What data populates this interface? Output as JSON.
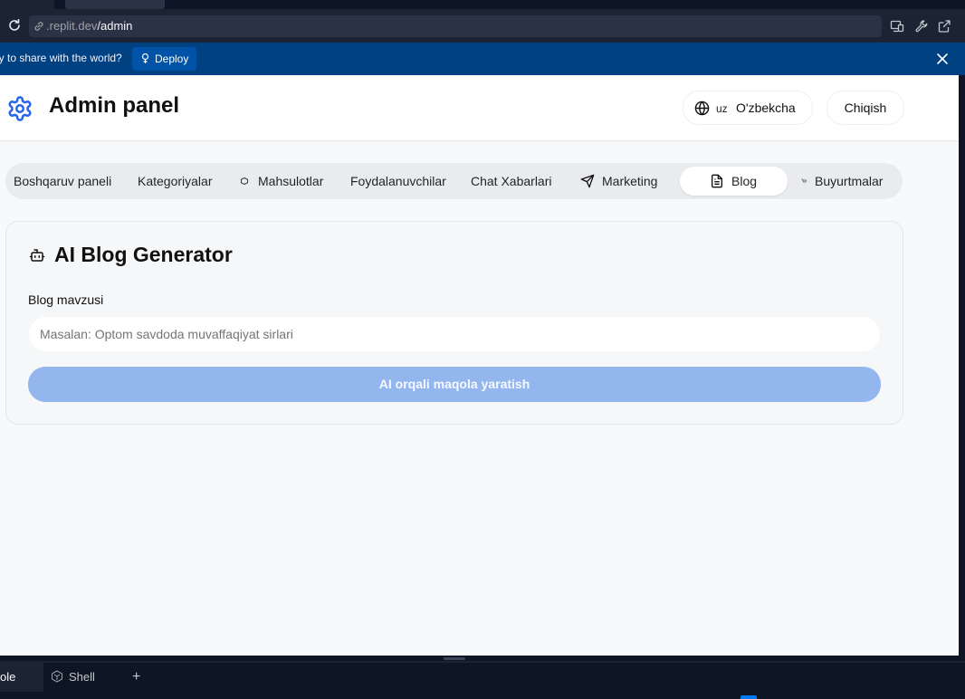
{
  "browser": {
    "url_prefix": ".replit.dev",
    "url_path": "/admin"
  },
  "banner": {
    "text": "ly to share with the world?",
    "deploy_label": "Deploy"
  },
  "header": {
    "title": "Admin panel",
    "language_code": "uz",
    "language_name": "O'zbekcha",
    "logout_label": "Chiqish"
  },
  "nav": {
    "items": [
      {
        "label": "Boshqaruv paneli"
      },
      {
        "label": "Kategoriyalar"
      },
      {
        "label": "Mahsulotlar"
      },
      {
        "label": "Foydalanuvchilar"
      },
      {
        "label": "Chat Xabarlari"
      },
      {
        "label": "Marketing"
      },
      {
        "label": "Blog"
      },
      {
        "label": "Buyurtmalar"
      }
    ],
    "active": "Blog"
  },
  "blog_generator": {
    "title": "AI Blog Generator",
    "topic_label": "Blog mavzusi",
    "topic_placeholder": "Masalan: Optom savdoda muvaffaqiyat sirlari",
    "generate_label": "AI orqali maqola yaratish"
  },
  "bottom_tabs": [
    {
      "label": "ole"
    },
    {
      "label": "Shell"
    }
  ],
  "colors": {
    "accent": "#2563eb",
    "banner_bg": "#004182",
    "button_disabled": "#94b6ef"
  }
}
